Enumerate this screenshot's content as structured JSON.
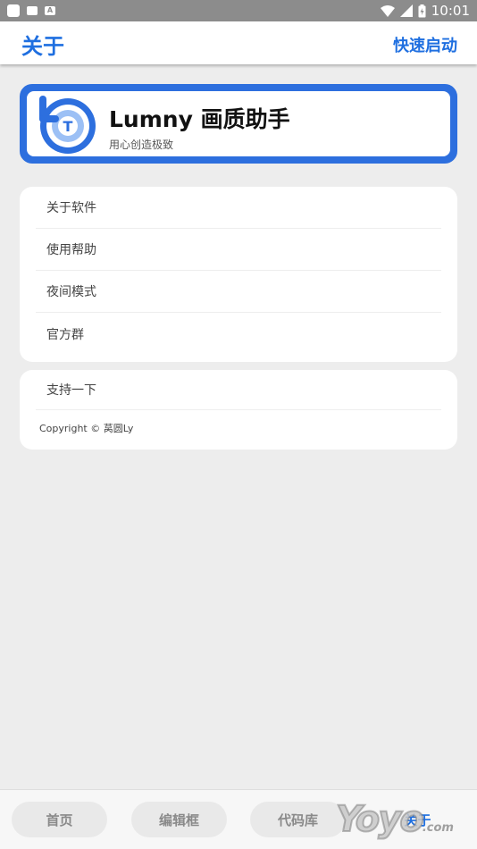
{
  "status_bar": {
    "left_badge": "A",
    "time": "10:01"
  },
  "header": {
    "title": "关于",
    "action": "快速启动"
  },
  "app_card": {
    "logo_letter": "T",
    "name": "Lumny 画质助手",
    "slogan": "用心创造极致"
  },
  "menu": {
    "items": [
      {
        "label": "关于软件"
      },
      {
        "label": "使用帮助"
      },
      {
        "label": "夜间模式"
      },
      {
        "label": "官方群"
      }
    ]
  },
  "support": {
    "label": "支持一下",
    "copyright": "Copyright © 莴圆Ly"
  },
  "bottom_nav": {
    "items": [
      {
        "label": "首页"
      },
      {
        "label": "编辑框"
      },
      {
        "label": "代码库"
      },
      {
        "label": "关于"
      }
    ],
    "active_index": 3
  },
  "watermark": {
    "text": "Yoyo",
    "suffix": ".com"
  },
  "colors": {
    "accent": "#1f6fe0",
    "card_border": "#2d6fde",
    "background": "#ededed"
  }
}
